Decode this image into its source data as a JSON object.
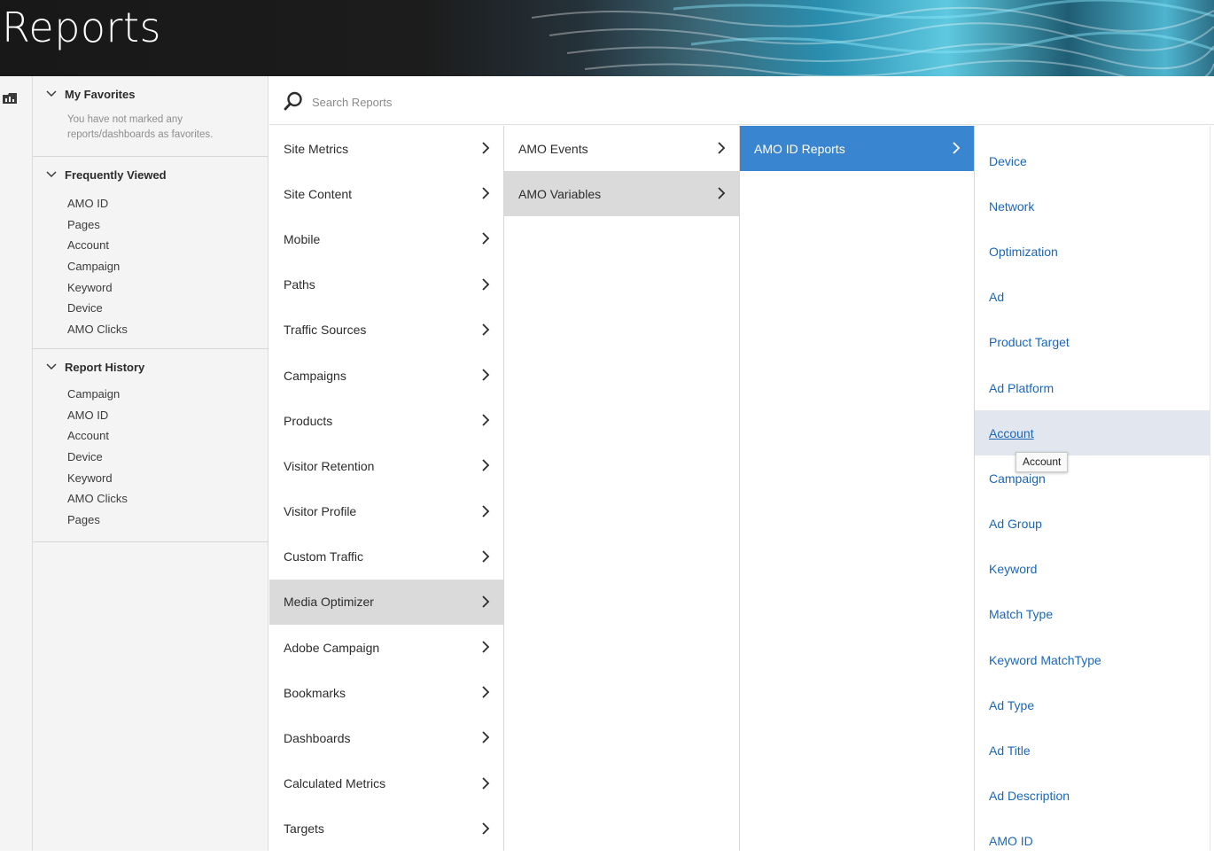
{
  "header": {
    "title": "Reports"
  },
  "rail": {
    "icon": "report-folder-icon"
  },
  "sidebar": {
    "favorites": {
      "title": "My Favorites",
      "empty_text": "You have not marked any reports/dashboards as favorites."
    },
    "frequently_viewed": {
      "title": "Frequently Viewed",
      "items": [
        "AMO ID",
        "Pages",
        "Account",
        "Campaign",
        "Keyword",
        "Device",
        "AMO Clicks"
      ]
    },
    "report_history": {
      "title": "Report History",
      "items": [
        "Campaign",
        "AMO ID",
        "Account",
        "Device",
        "Keyword",
        "AMO Clicks",
        "Pages"
      ]
    }
  },
  "search": {
    "placeholder": "Search Reports",
    "icon": "search-icon"
  },
  "columns": {
    "col1": [
      "Site Metrics",
      "Site Content",
      "Mobile",
      "Paths",
      "Traffic Sources",
      "Campaigns",
      "Products",
      "Visitor Retention",
      "Visitor Profile",
      "Custom Traffic",
      "Media Optimizer",
      "Adobe Campaign",
      "Bookmarks",
      "Dashboards",
      "Calculated Metrics",
      "Targets"
    ],
    "col1_active": "Media Optimizer",
    "col2": [
      "AMO Events",
      "AMO Variables"
    ],
    "col2_active": "AMO Variables",
    "col3": [
      "AMO ID Reports"
    ],
    "col3_selected": "AMO ID Reports",
    "col4": [
      "Device",
      "Network",
      "Optimization",
      "Ad",
      "Product Target",
      "Ad Platform",
      "Account",
      "Campaign",
      "Ad Group",
      "Keyword",
      "Match Type",
      "Keyword MatchType",
      "Ad Type",
      "Ad Title",
      "Ad Description",
      "AMO ID"
    ],
    "col4_hover": "Account"
  },
  "tooltip": {
    "text": "Account"
  },
  "colors": {
    "selected": "#3a85d0",
    "link": "#1b67b6",
    "active_bg": "#dadada",
    "hover_bg": "#e2e6ee"
  }
}
